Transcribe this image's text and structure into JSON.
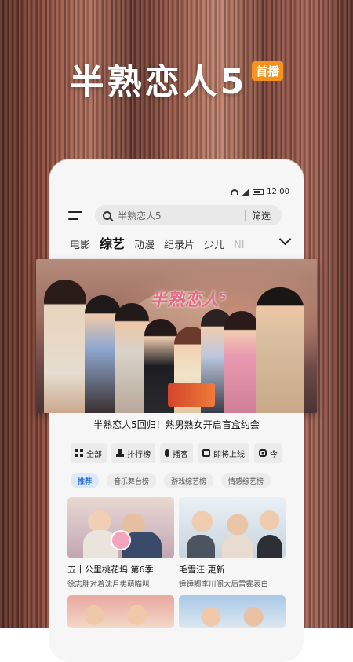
{
  "promo": {
    "title": "半熟恋人5",
    "badge": "首播"
  },
  "status_bar": {
    "time": "12:00"
  },
  "search": {
    "placeholder": "半熟恋人5",
    "filter_label": "筛选"
  },
  "tabs": [
    {
      "label": "电影"
    },
    {
      "label": "综艺",
      "active": true
    },
    {
      "label": "动漫"
    },
    {
      "label": "纪录片"
    },
    {
      "label": "少儿"
    },
    {
      "label": "NI"
    }
  ],
  "banner": {
    "logo_text": "半熟恋人⁵",
    "caption": "半熟恋人5回归！熟男熟女开启盲盒约会"
  },
  "categories": [
    {
      "label": "全部",
      "icon": "grid-icon"
    },
    {
      "label": "排行榜",
      "icon": "ranking-icon"
    },
    {
      "label": "播客",
      "icon": "mic-icon"
    },
    {
      "label": "即将上线",
      "icon": "calendar-icon"
    },
    {
      "label": "今",
      "icon": "tv-icon"
    }
  ],
  "tags": [
    {
      "label": "推荐",
      "active": true
    },
    {
      "label": "音乐舞台榜"
    },
    {
      "label": "游戏综艺榜"
    },
    {
      "label": "情感综艺榜"
    }
  ],
  "cards": [
    {
      "title": "五十公里桃花坞 第6季",
      "subtitle": "徐志胜对着沈月卖萌喵叫"
    },
    {
      "title": "毛雪汪·更新",
      "subtitle": "锤锤嘟李川阁大后雷霆表白"
    }
  ],
  "colors": {
    "accent_orange": "#f7921e",
    "active_tag_blue": "#2a6fe0"
  }
}
